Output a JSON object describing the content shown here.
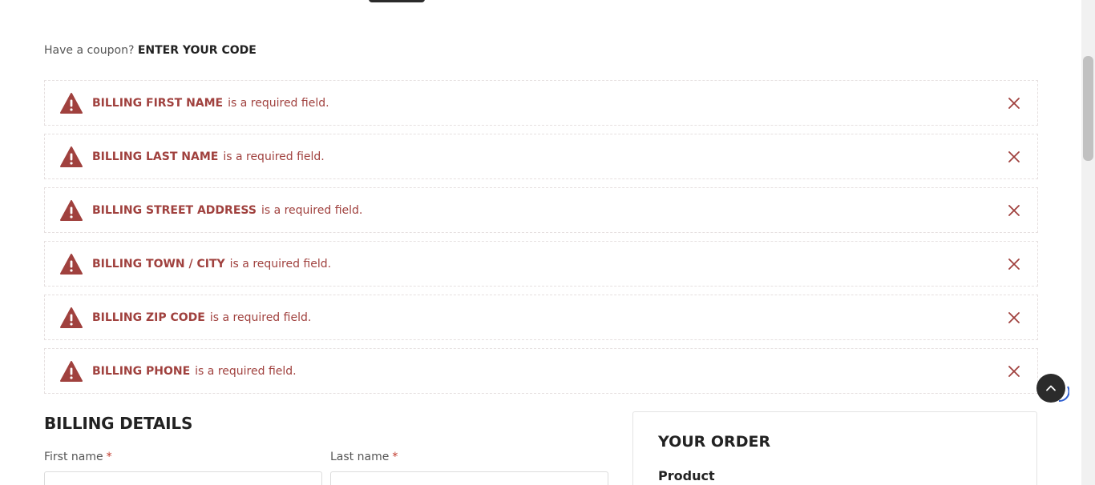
{
  "coupon": {
    "prompt": "Have a coupon?",
    "link": "ENTER YOUR CODE"
  },
  "notices": [
    {
      "field": "BILLING FIRST NAME",
      "message": "is a required field."
    },
    {
      "field": "BILLING LAST NAME",
      "message": "is a required field."
    },
    {
      "field": "BILLING STREET ADDRESS",
      "message": "is a required field."
    },
    {
      "field": "BILLING TOWN / CITY",
      "message": "is a required field."
    },
    {
      "field": "BILLING ZIP CODE",
      "message": "is a required field."
    },
    {
      "field": "BILLING PHONE",
      "message": "is a required field."
    }
  ],
  "billing": {
    "title": "BILLING DETAILS",
    "first_name_label": "First name",
    "last_name_label": "Last name",
    "required_mark": "*"
  },
  "order": {
    "title": "YOUR ORDER",
    "product_label": "Product"
  },
  "colors": {
    "error": "#a0413e",
    "dark": "#2b2b2b"
  },
  "icons": {
    "warning": "warning-triangle-icon",
    "close": "close-icon",
    "scroll_top": "chevron-up-icon"
  }
}
